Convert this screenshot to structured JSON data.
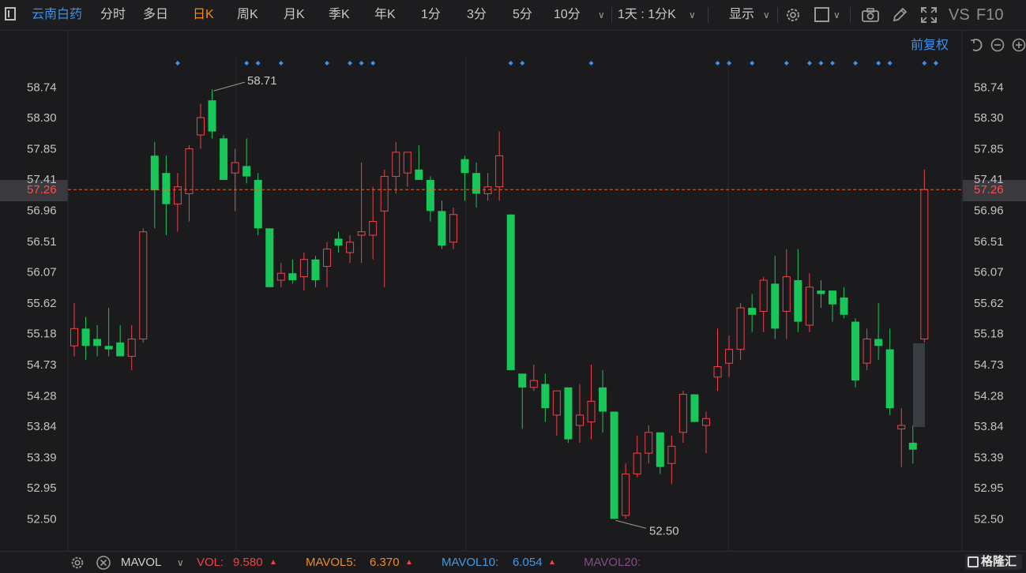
{
  "window_icon": "window-square-icon",
  "stock_name": "云南白药",
  "period_tabs": [
    {
      "label": "分时",
      "active": false
    },
    {
      "label": "多日",
      "active": false
    },
    {
      "label": "日K",
      "active": true
    },
    {
      "label": "周K",
      "active": false
    },
    {
      "label": "月K",
      "active": false
    },
    {
      "label": "季K",
      "active": false
    },
    {
      "label": "年K",
      "active": false
    },
    {
      "label": "1分",
      "active": false
    },
    {
      "label": "3分",
      "active": false
    },
    {
      "label": "5分",
      "active": false
    },
    {
      "label": "10分",
      "active": false
    }
  ],
  "multiperiod_label": "1天 : 1分K",
  "display_label": "显示",
  "toolbar_icons": [
    "gear-icon",
    "square-checkbox-icon",
    "camera-icon",
    "pencil-icon",
    "fullscreen-icon"
  ],
  "vs_label": "VS",
  "f10_label": "F10",
  "adjust_label": "前复权",
  "zoom_icons": [
    "undo-icon",
    "zoom-out-icon",
    "zoom-in-icon"
  ],
  "colors": {
    "up": "#f0424a",
    "down": "#19c65a",
    "marker": "#3d8fe8",
    "current_line": "#e8642e",
    "active_tab": "#f08a24",
    "current_tag_bg": "#3a3a3e",
    "current_tag_text": "#ff4d4d"
  },
  "chart_data": {
    "type": "candlestick",
    "title": "",
    "ylim": [
      52.2,
      59.1
    ],
    "y_ticks": [
      "58.74",
      "58.30",
      "57.85",
      "57.41",
      "56.96",
      "56.51",
      "56.07",
      "55.62",
      "55.18",
      "54.73",
      "54.28",
      "53.84",
      "53.39",
      "52.95",
      "52.50"
    ],
    "current_price": "57.26",
    "high_label": "58.71",
    "low_label": "52.50",
    "markers_at_candles": [
      9,
      15,
      16,
      18,
      22,
      24,
      25,
      26,
      38,
      39,
      45,
      56,
      57,
      59,
      62,
      64,
      65,
      66,
      68,
      70,
      71,
      74,
      75
    ],
    "candles": [
      {
        "o": 55.0,
        "h": 55.62,
        "l": 54.85,
        "c": 55.25
      },
      {
        "o": 55.25,
        "h": 55.42,
        "l": 54.8,
        "c": 55.0
      },
      {
        "o": 55.1,
        "h": 55.3,
        "l": 54.85,
        "c": 55.0
      },
      {
        "o": 55.0,
        "h": 55.55,
        "l": 54.85,
        "c": 54.95
      },
      {
        "o": 55.05,
        "h": 55.3,
        "l": 54.85,
        "c": 54.85
      },
      {
        "o": 54.85,
        "h": 55.3,
        "l": 54.65,
        "c": 55.1
      },
      {
        "o": 55.1,
        "h": 56.7,
        "l": 55.05,
        "c": 56.65
      },
      {
        "o": 57.75,
        "h": 57.95,
        "l": 56.7,
        "c": 57.25
      },
      {
        "o": 57.5,
        "h": 57.75,
        "l": 56.6,
        "c": 57.05
      },
      {
        "o": 57.05,
        "h": 57.5,
        "l": 56.65,
        "c": 57.3
      },
      {
        "o": 57.2,
        "h": 57.9,
        "l": 56.8,
        "c": 57.85
      },
      {
        "o": 58.05,
        "h": 58.5,
        "l": 57.85,
        "c": 58.3
      },
      {
        "o": 58.55,
        "h": 58.71,
        "l": 58.0,
        "c": 58.1
      },
      {
        "o": 58.0,
        "h": 58.05,
        "l": 57.4,
        "c": 57.4
      },
      {
        "o": 57.5,
        "h": 57.85,
        "l": 56.95,
        "c": 57.65
      },
      {
        "o": 57.6,
        "h": 58.0,
        "l": 57.35,
        "c": 57.45
      },
      {
        "o": 57.4,
        "h": 57.5,
        "l": 56.6,
        "c": 56.7
      },
      {
        "o": 56.7,
        "h": 56.7,
        "l": 55.85,
        "c": 55.85
      },
      {
        "o": 55.95,
        "h": 56.2,
        "l": 55.85,
        "c": 56.05
      },
      {
        "o": 56.05,
        "h": 56.25,
        "l": 55.9,
        "c": 55.95
      },
      {
        "o": 56.0,
        "h": 56.35,
        "l": 55.8,
        "c": 56.25
      },
      {
        "o": 56.25,
        "h": 56.3,
        "l": 55.85,
        "c": 55.95
      },
      {
        "o": 56.15,
        "h": 56.5,
        "l": 55.85,
        "c": 56.4
      },
      {
        "o": 56.55,
        "h": 56.65,
        "l": 56.35,
        "c": 56.45
      },
      {
        "o": 56.35,
        "h": 56.6,
        "l": 56.2,
        "c": 56.5
      },
      {
        "o": 56.6,
        "h": 57.65,
        "l": 56.2,
        "c": 56.65
      },
      {
        "o": 56.6,
        "h": 57.3,
        "l": 56.25,
        "c": 56.8
      },
      {
        "o": 56.95,
        "h": 57.55,
        "l": 55.85,
        "c": 57.45
      },
      {
        "o": 57.45,
        "h": 57.95,
        "l": 57.2,
        "c": 57.8
      },
      {
        "o": 57.5,
        "h": 57.8,
        "l": 57.3,
        "c": 57.8
      },
      {
        "o": 57.55,
        "h": 57.9,
        "l": 57.4,
        "c": 57.4
      },
      {
        "o": 57.4,
        "h": 57.45,
        "l": 56.8,
        "c": 56.95
      },
      {
        "o": 56.95,
        "h": 57.1,
        "l": 56.4,
        "c": 56.45
      },
      {
        "o": 56.5,
        "h": 57.0,
        "l": 56.4,
        "c": 56.9
      },
      {
        "o": 57.7,
        "h": 57.75,
        "l": 57.1,
        "c": 57.5
      },
      {
        "o": 57.5,
        "h": 57.65,
        "l": 57.0,
        "c": 57.2
      },
      {
        "o": 57.2,
        "h": 57.5,
        "l": 57.1,
        "c": 57.3
      },
      {
        "o": 57.3,
        "h": 58.1,
        "l": 57.1,
        "c": 57.75
      },
      {
        "o": 56.9,
        "h": 56.9,
        "l": 54.65,
        "c": 54.65
      },
      {
        "o": 54.6,
        "h": 54.6,
        "l": 53.8,
        "c": 54.4
      },
      {
        "o": 54.4,
        "h": 54.73,
        "l": 54.35,
        "c": 54.5
      },
      {
        "o": 54.45,
        "h": 54.6,
        "l": 53.9,
        "c": 54.1
      },
      {
        "o": 54.0,
        "h": 54.3,
        "l": 53.7,
        "c": 54.35
      },
      {
        "o": 54.4,
        "h": 54.4,
        "l": 53.6,
        "c": 53.65
      },
      {
        "o": 53.85,
        "h": 54.45,
        "l": 53.6,
        "c": 54.0
      },
      {
        "o": 53.9,
        "h": 54.73,
        "l": 53.65,
        "c": 54.2
      },
      {
        "o": 54.4,
        "h": 54.65,
        "l": 53.75,
        "c": 54.05
      },
      {
        "o": 54.05,
        "h": 54.05,
        "l": 52.5,
        "c": 52.5
      },
      {
        "o": 52.55,
        "h": 53.3,
        "l": 52.5,
        "c": 53.15
      },
      {
        "o": 53.15,
        "h": 53.7,
        "l": 53.1,
        "c": 53.45
      },
      {
        "o": 53.45,
        "h": 53.85,
        "l": 53.3,
        "c": 53.75
      },
      {
        "o": 53.75,
        "h": 53.75,
        "l": 53.15,
        "c": 53.25
      },
      {
        "o": 53.3,
        "h": 53.7,
        "l": 53.0,
        "c": 53.55
      },
      {
        "o": 53.75,
        "h": 54.35,
        "l": 53.6,
        "c": 54.3
      },
      {
        "o": 54.3,
        "h": 54.3,
        "l": 53.9,
        "c": 53.9
      },
      {
        "o": 53.85,
        "h": 54.05,
        "l": 53.45,
        "c": 53.95
      },
      {
        "o": 54.55,
        "h": 55.25,
        "l": 54.35,
        "c": 54.7
      },
      {
        "o": 54.75,
        "h": 55.15,
        "l": 54.55,
        "c": 54.95
      },
      {
        "o": 54.95,
        "h": 55.62,
        "l": 54.8,
        "c": 55.55
      },
      {
        "o": 55.55,
        "h": 55.75,
        "l": 55.2,
        "c": 55.45
      },
      {
        "o": 55.5,
        "h": 56.0,
        "l": 55.2,
        "c": 55.95
      },
      {
        "o": 55.9,
        "h": 56.3,
        "l": 55.1,
        "c": 55.25
      },
      {
        "o": 55.5,
        "h": 56.4,
        "l": 55.1,
        "c": 56.0
      },
      {
        "o": 55.95,
        "h": 56.4,
        "l": 55.2,
        "c": 55.35
      },
      {
        "o": 55.3,
        "h": 56.05,
        "l": 55.2,
        "c": 55.85
      },
      {
        "o": 55.8,
        "h": 55.95,
        "l": 55.55,
        "c": 55.75
      },
      {
        "o": 55.8,
        "h": 55.8,
        "l": 55.35,
        "c": 55.6
      },
      {
        "o": 55.7,
        "h": 55.85,
        "l": 55.4,
        "c": 55.45
      },
      {
        "o": 55.35,
        "h": 55.4,
        "l": 54.4,
        "c": 54.5
      },
      {
        "o": 54.75,
        "h": 55.25,
        "l": 54.65,
        "c": 55.1
      },
      {
        "o": 55.1,
        "h": 55.62,
        "l": 54.8,
        "c": 55.0
      },
      {
        "o": 54.95,
        "h": 55.25,
        "l": 54.0,
        "c": 54.1
      },
      {
        "o": 53.8,
        "h": 54.1,
        "l": 53.25,
        "c": 53.85
      },
      {
        "o": 53.6,
        "h": 53.85,
        "l": 53.3,
        "c": 53.5
      },
      {
        "o": 55.1,
        "h": 57.55,
        "l": 55.05,
        "c": 57.26
      }
    ]
  },
  "indicator": {
    "name": "MAVOL",
    "vol_label": "VOL:",
    "vol_value": "9.580",
    "mavol5_label": "MAVOL5:",
    "mavol5_value": "6.370",
    "mavol10_label": "MAVOL10:",
    "mavol10_value": "6.054",
    "mavol20_label": "MAVOL20:",
    "vol_color": "#f0424a",
    "mavol5_color": "#f08a24",
    "mavol10_color": "#3d9be8",
    "mavol20_color": "#8a4a8a"
  },
  "watermark": "格隆汇"
}
